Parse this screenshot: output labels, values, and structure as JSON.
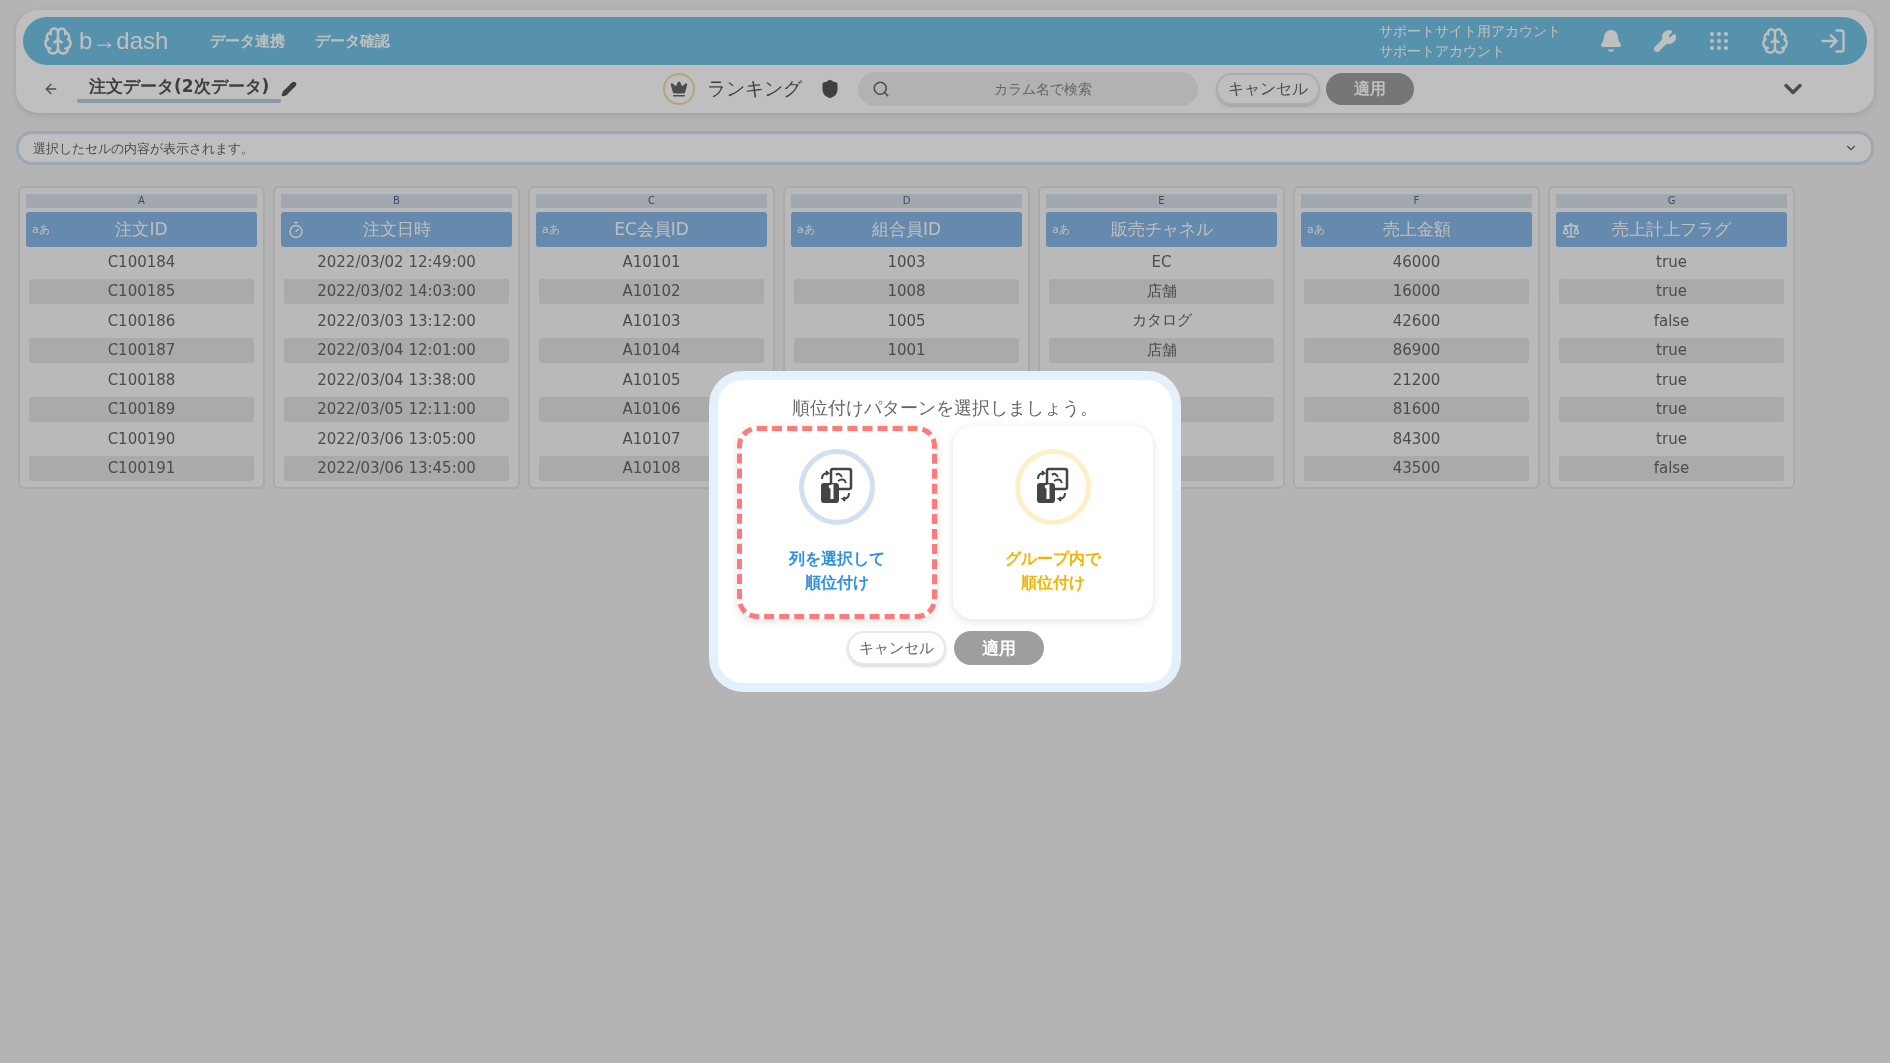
{
  "header": {
    "logo": "b→dash",
    "nav": [
      "データ連携",
      "データ確認"
    ],
    "account": [
      "サポートサイト用アカウント",
      "サポートアカウント"
    ]
  },
  "toolbar": {
    "title": "注文データ(2次データ)",
    "mode": "ランキング",
    "search": {
      "placeholder": "カラム名で検索"
    },
    "cancel": "キャンセル",
    "apply": {
      "label": "適用",
      "disabled": true
    }
  },
  "cell_preview": {
    "placeholder": "選択したセルの内容が表示されます。"
  },
  "columns": [
    {
      "letter": "A",
      "name": "注文ID",
      "kind": "text",
      "type_label": "aあ",
      "cells": [
        "C100184",
        "C100185",
        "C100186",
        "C100187",
        "C100188",
        "C100189",
        "C100190",
        "C100191"
      ]
    },
    {
      "letter": "B",
      "name": "注文日時",
      "kind": "datetime",
      "cells": [
        "2022/03/02 12:49:00",
        "2022/03/02 14:03:00",
        "2022/03/03 13:12:00",
        "2022/03/04 12:01:00",
        "2022/03/04 13:38:00",
        "2022/03/05 12:11:00",
        "2022/03/06 13:05:00",
        "2022/03/06 13:45:00"
      ]
    },
    {
      "letter": "C",
      "name": "EC会員ID",
      "kind": "text",
      "type_label": "aあ",
      "cells": [
        "A10101",
        "A10102",
        "A10103",
        "A10104",
        "A10105",
        "A10106",
        "A10107",
        "A10108"
      ]
    },
    {
      "letter": "D",
      "name": "組合員ID",
      "kind": "text",
      "type_label": "aあ",
      "cells": [
        "1003",
        "1008",
        "1005",
        "1001"
      ]
    },
    {
      "letter": "E",
      "name": "販売チャネル",
      "kind": "text",
      "type_label": "aあ",
      "cells": [
        "EC",
        "店舗",
        "カタログ",
        "店舗"
      ]
    },
    {
      "letter": "F",
      "name": "売上金額",
      "kind": "text",
      "type_label": "aあ",
      "cells": [
        "46000",
        "16000",
        "42600",
        "86900",
        "21200",
        "81600",
        "84300",
        "43500"
      ]
    },
    {
      "letter": "G",
      "name": "売上計上フラグ",
      "kind": "boolean",
      "cells": [
        "true",
        "true",
        "false",
        "true",
        "true",
        "true",
        "true",
        "false"
      ]
    }
  ],
  "modal": {
    "title": "順位付けパターンを選択しましょう。",
    "options": [
      {
        "lines": [
          "列を選択して",
          "順位付け"
        ],
        "color": "#2f8fe0",
        "selected": true
      },
      {
        "lines": [
          "グループ内で",
          "順位付け"
        ],
        "color": "#f2b400",
        "selected": false
      }
    ],
    "cancel": "キャンセル",
    "apply": {
      "label": "適用",
      "disabled": true
    }
  }
}
